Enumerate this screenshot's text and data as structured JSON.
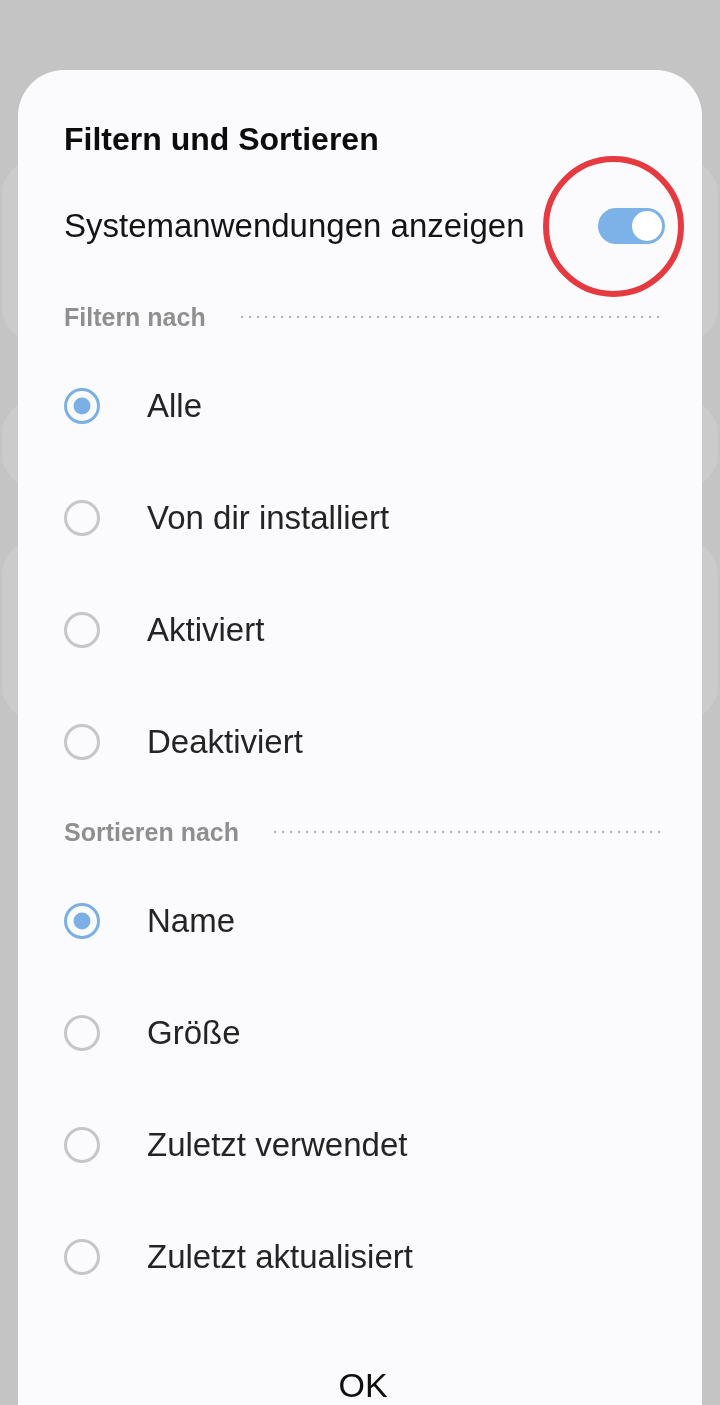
{
  "dialog": {
    "title": "Filtern und Sortieren"
  },
  "system_apps": {
    "label": "Systemanwendungen anzeigen",
    "on": true,
    "highlighted": true
  },
  "sections": [
    {
      "heading": "Filtern nach",
      "options": [
        {
          "label": "Alle",
          "selected": true
        },
        {
          "label": "Von dir installiert",
          "selected": false
        },
        {
          "label": "Aktiviert",
          "selected": false
        },
        {
          "label": "Deaktiviert",
          "selected": false
        }
      ]
    },
    {
      "heading": "Sortieren nach",
      "options": [
        {
          "label": "Name",
          "selected": true
        },
        {
          "label": "Größe",
          "selected": false
        },
        {
          "label": "Zuletzt verwendet",
          "selected": false
        },
        {
          "label": "Zuletzt aktualisiert",
          "selected": false
        }
      ]
    }
  ],
  "buttons": [
    "OK"
  ]
}
